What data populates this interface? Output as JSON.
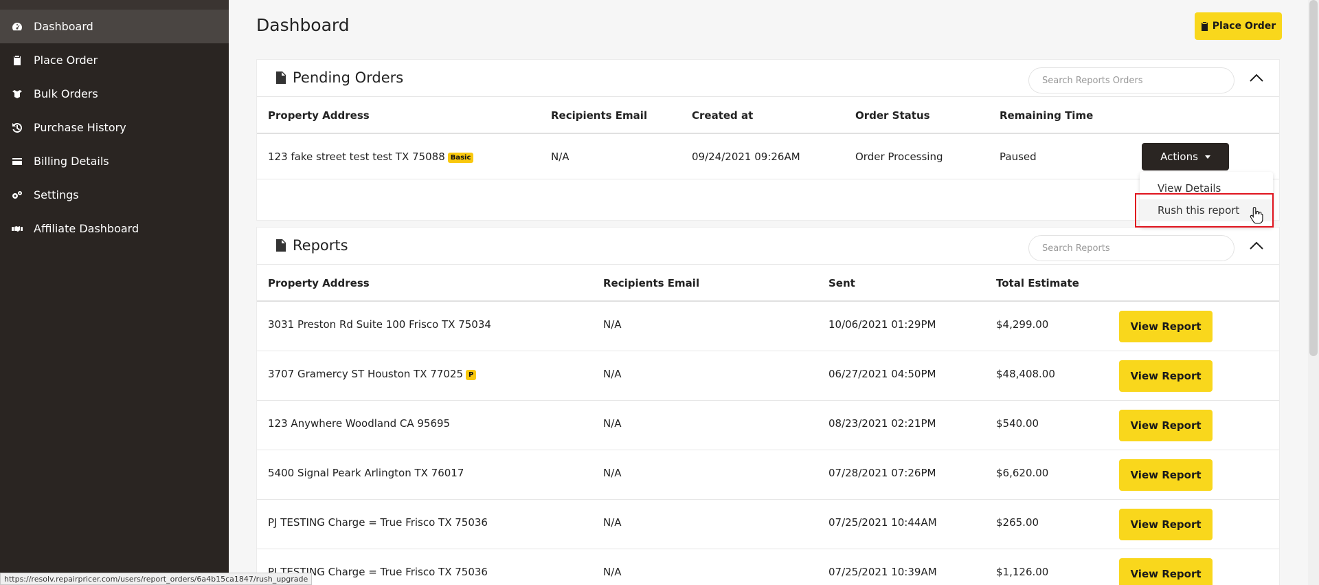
{
  "sidebar": {
    "items": [
      {
        "label": "Dashboard",
        "icon": "dashboard-icon",
        "active": true
      },
      {
        "label": "Place Order",
        "icon": "clipboard-icon"
      },
      {
        "label": "Bulk Orders",
        "icon": "boxes-icon"
      },
      {
        "label": "Purchase History",
        "icon": "history-icon"
      },
      {
        "label": "Billing Details",
        "icon": "credit-card-icon"
      },
      {
        "label": "Settings",
        "icon": "gears-icon"
      },
      {
        "label": "Affiliate Dashboard",
        "icon": "handshake-icon"
      }
    ]
  },
  "header": {
    "title": "Dashboard",
    "place_order_label": "Place Order"
  },
  "pending_orders": {
    "title": "Pending Orders",
    "search_placeholder": "Search Reports Orders",
    "columns": [
      "Property Address",
      "Recipients Email",
      "Created at",
      "Order Status",
      "Remaining Time"
    ],
    "rows": [
      {
        "address": "123 fake street test test TX 75088",
        "badge": "Basic",
        "email": "N/A",
        "created_at": "09/24/2021 09:26AM",
        "status": "Order Processing",
        "remaining": "Paused",
        "actions_label": "Actions"
      }
    ],
    "dropdown": [
      "View Details",
      "Rush this report"
    ]
  },
  "reports": {
    "title": "Reports",
    "search_placeholder": "Search Reports",
    "columns": [
      "Property Address",
      "Recipients Email",
      "Sent",
      "Total Estimate"
    ],
    "view_label": "View Report",
    "rows": [
      {
        "address": "3031 Preston Rd Suite 100 Frisco TX 75034",
        "badge": "",
        "email": "N/A",
        "sent": "10/06/2021 01:29PM",
        "total": "$4,299.00"
      },
      {
        "address": "3707 Gramercy ST Houston TX 77025",
        "badge": "P",
        "email": "N/A",
        "sent": "06/27/2021 04:50PM",
        "total": "$48,408.00"
      },
      {
        "address": "123 Anywhere Woodland CA 95695",
        "badge": "",
        "email": "N/A",
        "sent": "08/23/2021 02:21PM",
        "total": "$540.00"
      },
      {
        "address": "5400 Signal Peark Arlington TX 76017",
        "badge": "",
        "email": "N/A",
        "sent": "07/28/2021 07:26PM",
        "total": "$6,620.00"
      },
      {
        "address": "PJ TESTING Charge = True Frisco TX 75036",
        "badge": "",
        "email": "N/A",
        "sent": "07/25/2021 10:44AM",
        "total": "$265.00"
      },
      {
        "address": "PJ TESTING Charge = True Frisco TX 75036",
        "badge": "",
        "email": "N/A",
        "sent": "07/25/2021 10:39AM",
        "total": "$1,126.00"
      }
    ]
  },
  "status_bar": {
    "url": "https://resolv.repairpricer.com/users/report_orders/6a4b15ca1847/rush_upgrade"
  },
  "colors": {
    "sidebar_bg": "#2a2522",
    "accent_yellow": "#f9d71c",
    "highlight_red": "#e0141e"
  }
}
